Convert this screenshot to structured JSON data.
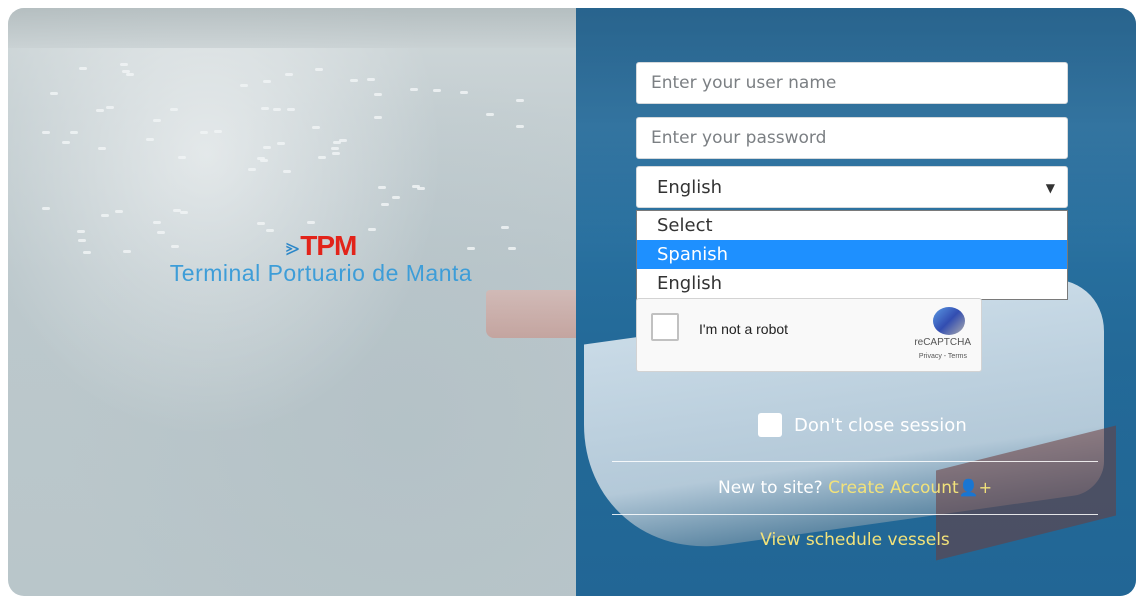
{
  "brand": {
    "logo_mark": "TPM",
    "logo_text": "Terminal Portuario de Manta",
    "logo_color": "#e2231a",
    "text_color": "#3d9dd8"
  },
  "login": {
    "username_placeholder": "Enter your user name",
    "password_placeholder": "Enter your password",
    "language_selected": "English",
    "language_options": [
      "Select",
      "Spanish",
      "English"
    ],
    "highlighted_option": "Spanish",
    "captcha_label": "I'm not a robot",
    "captcha_brand": "reCAPTCHA",
    "captcha_terms": "Privacy - Terms",
    "keep_session_label": "Don't close session",
    "new_to_site": "New to site?",
    "create_account": "Create Account",
    "view_schedule": "View schedule vessels",
    "accent_link_color": "#f2e27a",
    "highlight_color": "#1e90ff"
  }
}
